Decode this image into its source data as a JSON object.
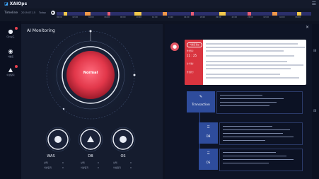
{
  "app": {
    "title": "XAIOps"
  },
  "timeline": {
    "label": "Timeline",
    "date": "2019.07.15",
    "mode": "Today",
    "ticks": [
      "00:00",
      "02:00",
      "04:00",
      "06:00",
      "08:00",
      "10:00",
      "12:00",
      "14:00",
      "16:00",
      "18:00",
      "20:00",
      "22:00",
      "24:00",
      "02:00",
      "04:00",
      "06:00"
    ]
  },
  "sidebar": {
    "items": [
      {
        "label": "대시보드",
        "icon": "alert-user-icon"
      },
      {
        "label": "이벤트",
        "icon": "eye-icon"
      },
      {
        "label": "이상탐지",
        "icon": "warning-icon"
      }
    ]
  },
  "ai_monitoring": {
    "title": "AI Monitoring",
    "status": "Normal",
    "nodes": [
      {
        "name": "WAS",
        "row1_label": "상태",
        "row1_value": "0",
        "row2_label": "이상탐지",
        "row2_value": "0"
      },
      {
        "name": "DB",
        "row1_label": "상태",
        "row1_value": "0",
        "row2_label": "이상탐지",
        "row2_value": "0"
      },
      {
        "name": "OS",
        "row1_label": "상태",
        "row1_value": "0",
        "row2_label": "이상탐지",
        "row2_value": "0"
      }
    ]
  },
  "detail": {
    "close": "×",
    "card": {
      "tag": "이벤트정보",
      "date_label": "발생일자",
      "time": "11 : 25",
      "row_a": "분석대상",
      "row_b": "발생원인"
    },
    "transaction_label": "Transaction",
    "db_label": "DB",
    "os_label": "OS"
  },
  "colors": {
    "accent": "#2e4c9c",
    "alert": "#d9343f",
    "core": "#e2374a"
  }
}
